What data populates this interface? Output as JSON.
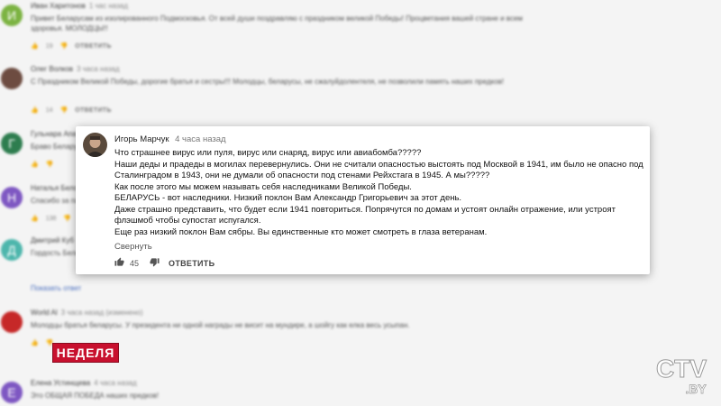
{
  "background_comments": [
    {
      "avatar_letter": "И",
      "avatar_color": "#7cb342",
      "author": "Иван Харитонов",
      "time": "1 час назад",
      "text": "Привет Беларусам из изолированного Подмосковья. От всей души поздравляю с праздником великой Победы! Процветания вашей стране и всем здоровья. МОЛОДЦЫ!!",
      "likes": "19",
      "reply": "ОТВЕТИТЬ"
    },
    {
      "avatar_letter": "",
      "avatar_color": "#6d4c41",
      "author": "Олег Волков",
      "time": "3 часа назад",
      "text": "С Праздником Великой Победы, дорогие братья и сестры!!! Молодцы, беларусы, не сжалуйдолентеля, не позволили память наших предков!",
      "likes": "14",
      "reply": "ОТВЕТИТЬ"
    },
    {
      "avatar_letter": "Г",
      "avatar_color": "#2e7d4f",
      "author": "Гульнара Апа",
      "time": "",
      "text": "Браво Беларусь",
      "likes": "",
      "reply": ""
    },
    {
      "avatar_letter": "Н",
      "avatar_color": "#7e57c2",
      "author": "Наталья Бело",
      "time": "",
      "text": "Спасибо за память",
      "likes": "138",
      "reply": ""
    },
    {
      "avatar_letter": "Д",
      "avatar_color": "#4db6ac",
      "author": "Дмитрий Куб",
      "time": "",
      "text": "Гордость Бела",
      "likes": "",
      "reply": "",
      "show_replies": "Показать ответ"
    },
    {
      "avatar_letter": "",
      "avatar_color": "#c62828",
      "author": "World Al",
      "time": "3 часа назад (изменено)",
      "text": "Молодцы братья беларусы. У президента ни одной награды не висит на мундире, а шойгу как елка весь усыпан.",
      "likes": "",
      "reply": ""
    },
    {
      "avatar_letter": "Е",
      "avatar_color": "#7e57c2",
      "author": "Елена Устинщева",
      "time": "4 часа назад",
      "text": "Это ОБЩАЯ ПОБЕДА наших предков!",
      "likes": "",
      "reply": ""
    }
  ],
  "highlighted_comment": {
    "author": "Игорь Марчук",
    "time": "4 часа назад",
    "lines": [
      "Что страшнее вирус или пуля, вирус или снаряд, вирус или авиабомба?????",
      "Наши деды и прадеды в могилах перевернулись. Они не считали опасностью выстоять под Москвой в 1941, им было не опасно под",
      "Сталинградом в 1943, они не думали об опасности под стенами Рейхстага в 1945. А мы?????",
      "Как после этого мы можем называть себя наследниками Великой Победы.",
      "БЕЛАРУСЬ - вот наследники. Низкий поклон Вам Александр Григорьевич за этот день.",
      "Даже страшно представить, что будет если 1941 повториться. Попрячутся по домам и устоят онлайн отражение, или устроят",
      "флэшмоб чтобы супостат испугался.",
      "Еще раз низкий поклон Вам сябры. Вы единственные кто может смотреть в глаза ветеранам."
    ],
    "collapse_label": "Свернуть",
    "likes": "45",
    "reply_label": "ОТВЕТИТЬ"
  },
  "overlay": {
    "program_logo": "НЕДЕЛЯ",
    "channel_logo_main": "CTV",
    "channel_logo_sub": ".BY"
  },
  "icons": {
    "like": "thumb-up-icon",
    "dislike": "thumb-down-icon"
  }
}
